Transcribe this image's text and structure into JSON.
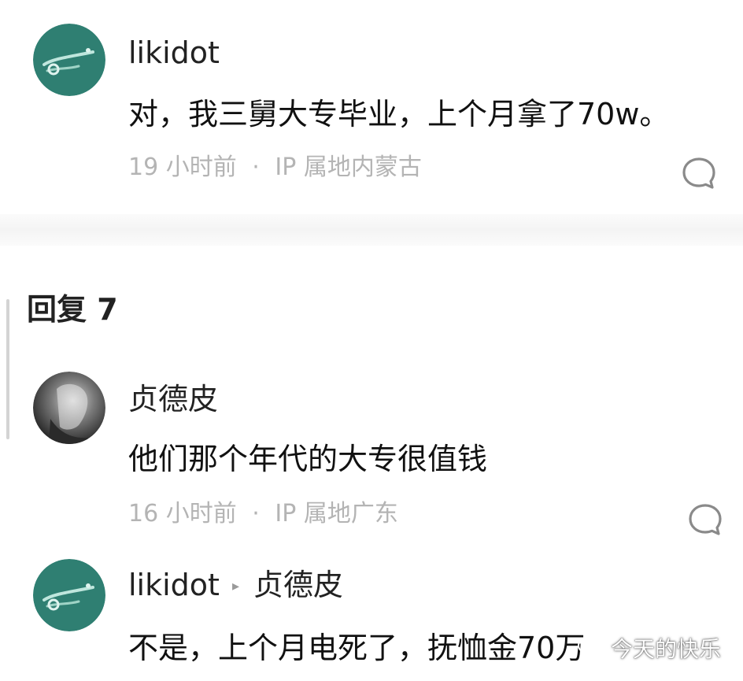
{
  "comment": {
    "username": "likidot",
    "text": "对，我三舅大专毕业，上个月拿了70w。",
    "time": "19 小时前",
    "separator": "·",
    "ip_location": "IP 属地内蒙古"
  },
  "replies": {
    "header": "回复 7",
    "items": [
      {
        "username": "贞德皮",
        "text": "他们那个年代的大专很值钱",
        "time": "16 小时前",
        "separator": "·",
        "ip_location": "IP 属地广东"
      },
      {
        "username": "likidot",
        "arrow": "▸",
        "reply_to": "贞德皮",
        "text": "不是，上个月电死了，抚恤金70万"
      }
    ]
  },
  "watermark": {
    "text": "今天的快乐",
    "icon": "wechat-icon"
  },
  "colors": {
    "avatar_teal": "#2f7f72",
    "meta_gray": "#b4b4b4",
    "text_dark": "#111111"
  }
}
